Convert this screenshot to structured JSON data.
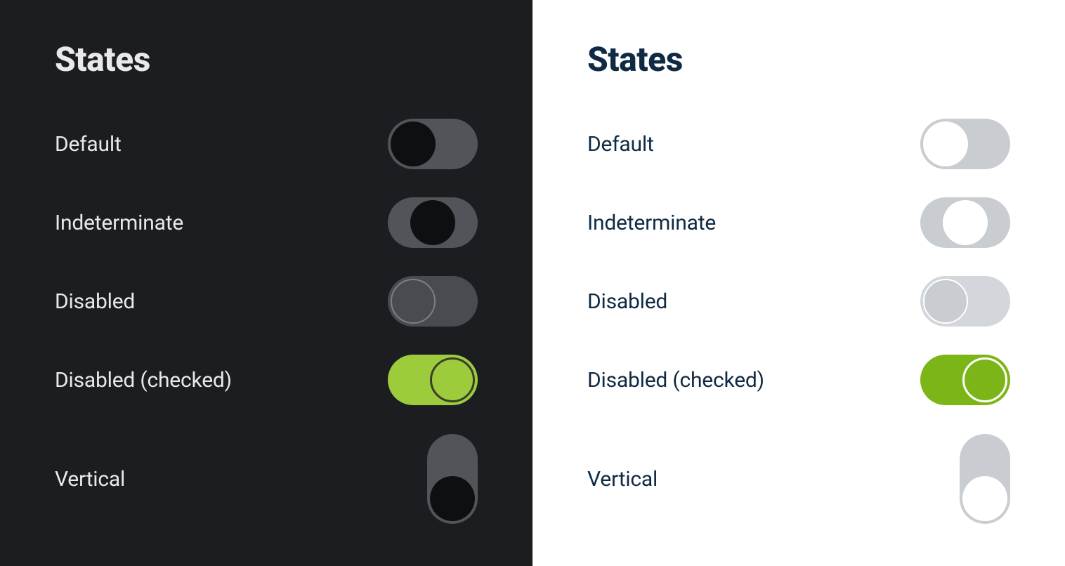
{
  "heading": "States",
  "rows": {
    "default": "Default",
    "indeterminate": "Indeterminate",
    "disabled": "Disabled",
    "disabled_checked": "Disabled (checked)",
    "vertical": "Vertical"
  },
  "colors": {
    "dark_bg": "#1b1d21",
    "dark_text": "#e9e9ea",
    "dark_track": "#515459",
    "dark_knob": "#0e0f10",
    "light_bg": "#ffffff",
    "light_text": "#102a43",
    "light_track": "#c9ccd0",
    "light_knob": "#ffffff",
    "accent_dark": "#9ccc3c",
    "accent_light": "#7cb518"
  }
}
